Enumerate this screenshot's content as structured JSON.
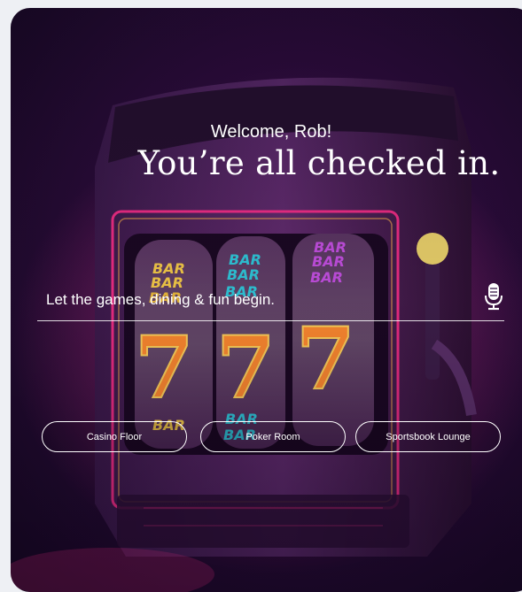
{
  "greeting": "Welcome, Rob!",
  "headline": "You’re all checked in.",
  "search": {
    "placeholder": "Let the games, dining & fun begin."
  },
  "icons": {
    "mic": "microphone-icon"
  },
  "reels": [
    [
      "BAR",
      "BAR",
      "BAR"
    ],
    [
      "BAR",
      "BAR",
      "BAR"
    ],
    [
      "BAR",
      "BAR",
      "BAR"
    ]
  ],
  "sevens": [
    "7",
    "7",
    "7"
  ],
  "buttons": [
    {
      "label": "Casino Floor"
    },
    {
      "label": "Poker Room"
    },
    {
      "label": "Sportsbook Lounge"
    }
  ],
  "colors": {
    "accent": "#ff2f8a",
    "background": "#2b0c3a",
    "text": "#ffffff"
  }
}
